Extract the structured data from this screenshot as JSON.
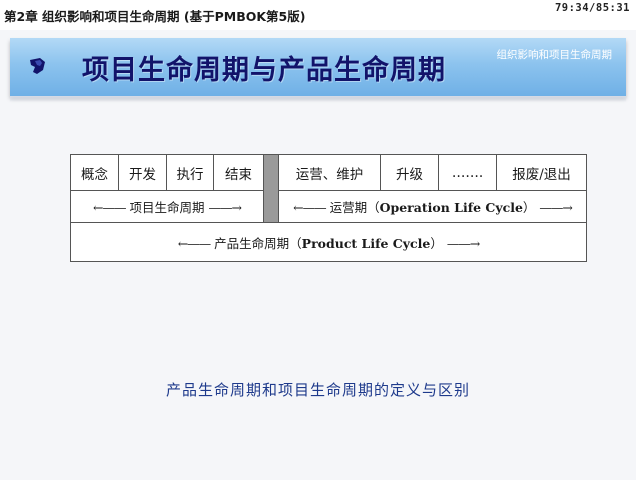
{
  "header": {
    "chapter_title": "第2章 组织影响和项目生命周期 (基于PMBOK第5版)",
    "timer": "79:34/85:31"
  },
  "banner": {
    "title": "项目生命周期与产品生命周期",
    "subtitle": "组织影响和项目生命周期",
    "icon": "ribbon-bullet-icon"
  },
  "lifecycle_table": {
    "project_phases": [
      "概念",
      "开发",
      "执行",
      "结束"
    ],
    "operation_phases": [
      "运营、维护",
      "升级",
      "…….",
      "报废/退出"
    ],
    "project_label": "项目生命周期",
    "operation_label_cn": "运营期（",
    "operation_label_en": "Operation Life Cycle",
    "operation_label_close": "）",
    "product_label_cn": "产品生命周期（",
    "product_label_en": "Product Life Cycle",
    "product_label_close": "）",
    "arrow_left": "←——",
    "arrow_right": "——→",
    "divider_color": "#9a9a9a"
  },
  "caption": "产品生命周期和项目生命周期的定义与区别",
  "colors": {
    "banner_title": "#12136a",
    "caption": "#1e3a8c",
    "banner_top": "#b3d9f6",
    "banner_bottom": "#6fb0e6"
  }
}
